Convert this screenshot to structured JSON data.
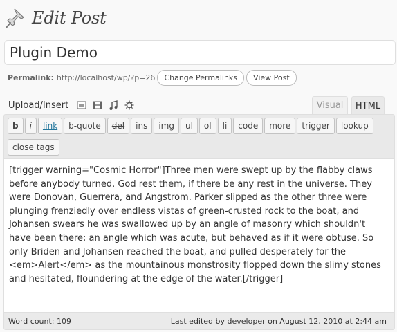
{
  "header": {
    "icon": "pushpin-icon",
    "title": "Edit Post"
  },
  "post": {
    "title": "Plugin Demo"
  },
  "permalink": {
    "label": "Permalink:",
    "url": "http://localhost/wp/?p=26",
    "change_button": "Change Permalinks",
    "view_button": "View Post"
  },
  "upload": {
    "label": "Upload/Insert",
    "icons": [
      "add-image-icon",
      "add-video-icon",
      "add-audio-icon",
      "add-media-icon"
    ]
  },
  "tabs": {
    "visual": "Visual",
    "html": "HTML",
    "active": "HTML"
  },
  "quicktags": [
    "b",
    "i",
    "link",
    "b-quote",
    "del",
    "ins",
    "img",
    "ul",
    "ol",
    "li",
    "code",
    "more",
    "trigger",
    "lookup",
    "close tags"
  ],
  "content": {
    "text": "[trigger warning=\"Cosmic Horror\"]Three men were swept up by the flabby claws before anybody turned. God rest them, if there be any rest in the universe. They were Donovan, Guerrera, and Angstrom. Parker slipped as the other three were plunging frenziedly over endless vistas of green-crusted rock to the boat, and Johansen swears he was swallowed up by an angle of masonry which shouldn't have been there; an angle which was acute, but behaved as if it were obtuse. So only Briden and Johansen reached the boat, and pulled desperately for the <em>Alert</em> as the mountainous monstrosity flopped down the slimy stones and hesitated, floundering at the edge of the water.[/trigger]"
  },
  "status": {
    "word_count": "Word count: 109",
    "last_edited": "Last edited by developer on August 12, 2010 at 2:44 am"
  },
  "colors": {
    "link": "#21759b",
    "background": "#f9f9f9",
    "toolbar": "#e9e9e9"
  }
}
